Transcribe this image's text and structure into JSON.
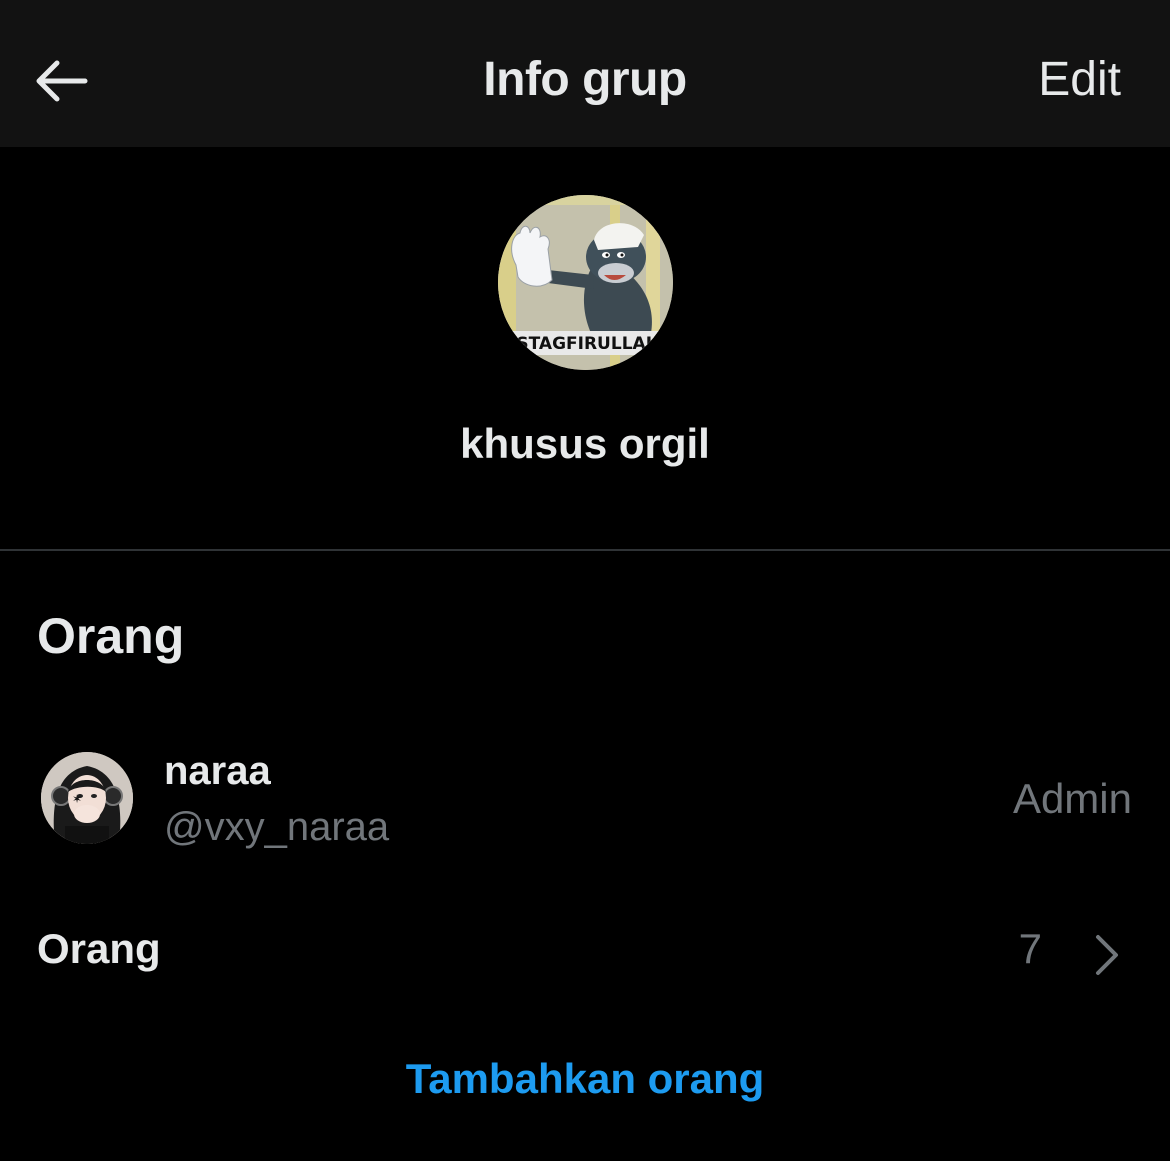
{
  "header": {
    "title": "Info grup",
    "edit_label": "Edit",
    "back_icon": "arrow-left-icon"
  },
  "group": {
    "name": "khusus orgil",
    "avatar_caption": "ISTAGFIRULLAH"
  },
  "people_section": {
    "title": "Orang",
    "members": [
      {
        "name": "naraa",
        "handle": "@vxy_naraa",
        "role": "Admin"
      }
    ],
    "people_row": {
      "label": "Orang",
      "count": "7",
      "icon": "chevron-right-icon"
    },
    "add_label": "Tambahkan orang"
  },
  "colors": {
    "background": "#000000",
    "header_background": "#121212",
    "primary_text": "#e7e9ea",
    "secondary_text": "#71767b",
    "accent": "#1d9bf0",
    "divider": "#2f3336"
  }
}
